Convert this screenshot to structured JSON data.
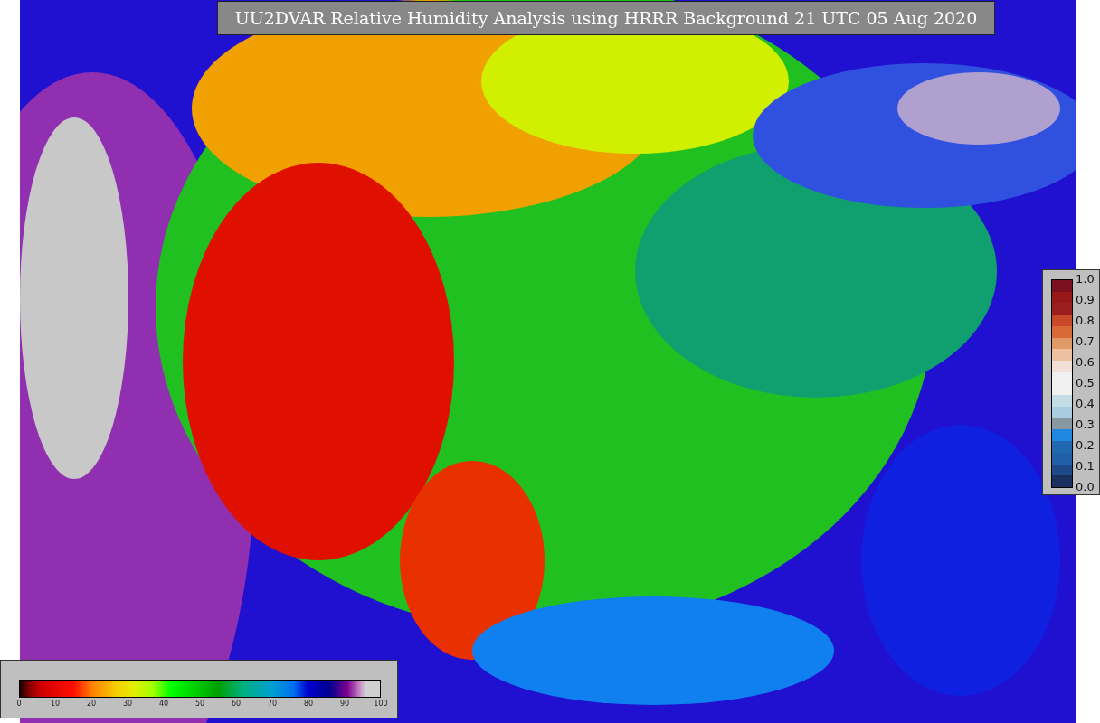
{
  "title": "UU2DVAR Relative Humidity Analysis using HRRR Background 21 UTC 05 Aug 2020",
  "humidity_colorbar": {
    "ticks": [
      "0",
      "10",
      "20",
      "30",
      "40",
      "50",
      "60",
      "70",
      "80",
      "90",
      "100"
    ]
  },
  "ratio_colorbar": {
    "ticks": [
      "1.0",
      "0.9",
      "0.8",
      "0.7",
      "0.6",
      "0.5",
      "0.4",
      "0.3",
      "0.2",
      "0.1",
      "0.0"
    ]
  }
}
